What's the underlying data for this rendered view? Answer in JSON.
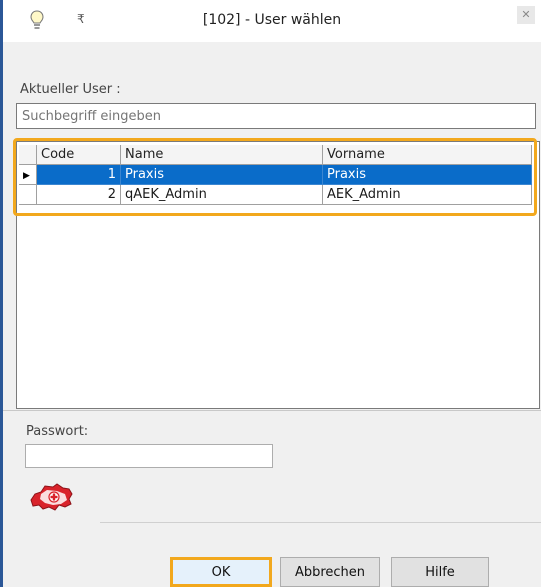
{
  "window": {
    "title": "[102] - User wählen",
    "quick_access": "₹",
    "close_glyph": "✕"
  },
  "labels": {
    "aktueller_user": "Aktueller User :",
    "passwort": "Passwort:"
  },
  "search": {
    "placeholder": "Suchbegriff eingeben"
  },
  "grid": {
    "columns": [
      "",
      "Code",
      "Name",
      "Vorname"
    ],
    "rows": [
      {
        "indicator": "▶",
        "code": "1",
        "name": "Praxis",
        "vorname": "Praxis",
        "selected": true
      },
      {
        "indicator": "",
        "code": "2",
        "name": "qAEK_Admin",
        "vorname": "AEK_Admin",
        "selected": false
      }
    ]
  },
  "password": {
    "value": ""
  },
  "buttons": {
    "ok": "OK",
    "abbrechen": "Abbrechen",
    "hilfe": "Hilfe"
  },
  "colors": {
    "selection": "#0a6cc9",
    "highlight": "#f2a81d",
    "window_border": "#2b5797"
  }
}
